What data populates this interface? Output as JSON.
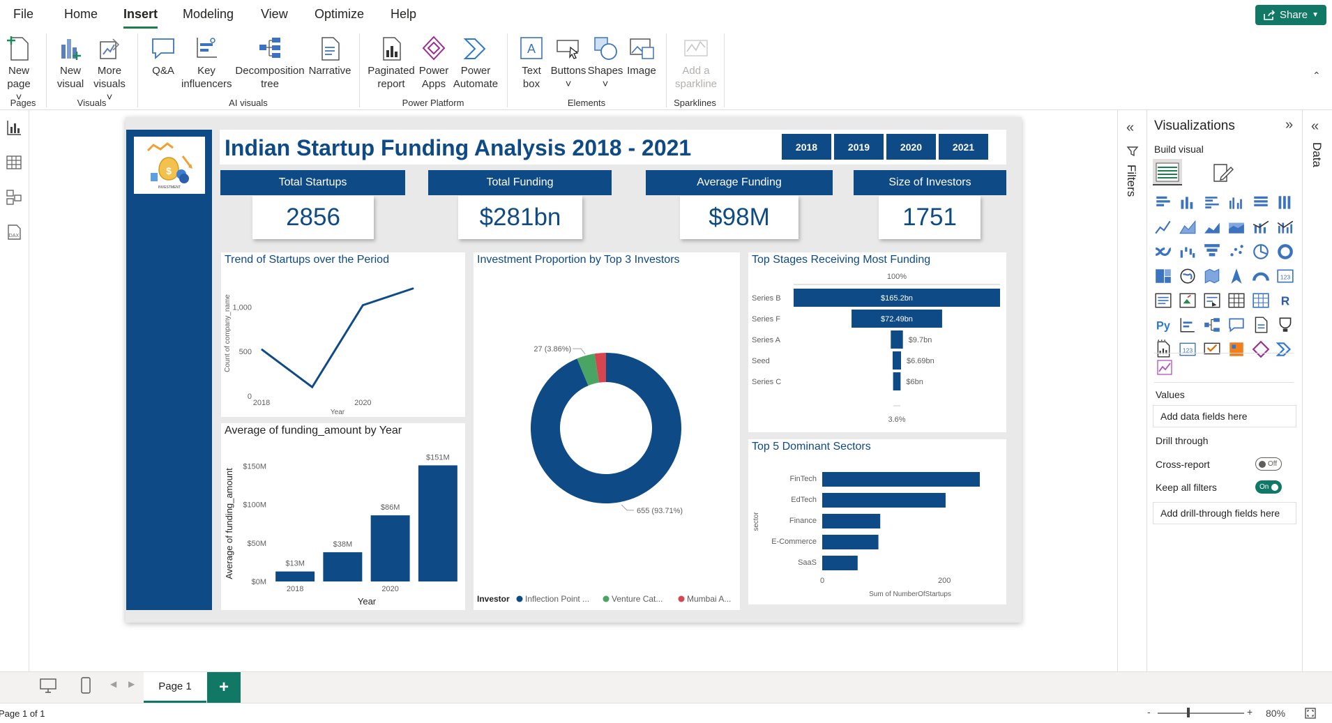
{
  "menu": {
    "items": [
      "File",
      "Home",
      "Insert",
      "Modeling",
      "View",
      "Optimize",
      "Help"
    ],
    "active": "Insert",
    "share_label": "Share"
  },
  "ribbon": {
    "new_page": [
      "New",
      "page"
    ],
    "new_visual": [
      "New",
      "visual"
    ],
    "more_visuals": [
      "More",
      "visuals"
    ],
    "qna": "Q&A",
    "key_influencers": [
      "Key",
      "influencers"
    ],
    "decomposition_tree": [
      "Decomposition",
      "tree"
    ],
    "narrative": "Narrative",
    "paginated_report": [
      "Paginated",
      "report"
    ],
    "power_apps": [
      "Power",
      "Apps"
    ],
    "power_automate": [
      "Power",
      "Automate"
    ],
    "text_box": [
      "Text",
      "box"
    ],
    "buttons": "Buttons",
    "shapes": "Shapes",
    "image": "Image",
    "add_sparkline": [
      "Add a",
      "sparkline"
    ],
    "groups": {
      "pages": "Pages",
      "visuals": "Visuals",
      "ai_visuals": "AI visuals",
      "power_platform": "Power Platform",
      "elements": "Elements",
      "sparklines": "Sparklines"
    }
  },
  "dashboard": {
    "title": "Indian Startup Funding Analysis 2018 - 2021",
    "logo_caption": "INVESTMENT",
    "year_buttons": [
      "2018",
      "2019",
      "2020",
      "2021"
    ],
    "kpis": [
      {
        "label": "Total Startups",
        "value": "2856"
      },
      {
        "label": "Total Funding",
        "value": "$281bn"
      },
      {
        "label": "Average Funding",
        "value": "$98M"
      },
      {
        "label": "Size of Investors",
        "value": "1751"
      }
    ]
  },
  "chart_data": [
    {
      "type": "line",
      "title": "Trend of Startups over the Period",
      "xlabel": "Year",
      "ylabel": "Count of company_name",
      "x": [
        2018,
        2019,
        2020,
        2021
      ],
      "x_ticks": [
        "2018",
        "2020"
      ],
      "y_ticks": [
        "0",
        "500",
        "1,000"
      ],
      "ylim": [
        0,
        1300
      ],
      "series": [
        {
          "values": [
            525,
            100,
            1020,
            1210
          ]
        }
      ]
    },
    {
      "type": "donut",
      "title": "Investment Proportion by Top 3 Investors",
      "legend_title": "Investor",
      "legend": [
        "Inflection Point ...",
        "Venture Cat...",
        "Mumbai A..."
      ],
      "colors": [
        "#0e4a85",
        "#4aa564",
        "#d64550"
      ],
      "values": [
        655,
        27,
        17
      ],
      "labels": [
        "655 (93.71%)",
        "27 (3.86%)",
        ""
      ]
    },
    {
      "type": "funnel",
      "title": "Top Stages Receiving Most Funding",
      "top_pct": "100%",
      "bottom_pct": "3.6%",
      "categories": [
        "Series B",
        "Series F",
        "Series A",
        "Seed",
        "Series C"
      ],
      "values": [
        165.2,
        72.49,
        9.7,
        6.69,
        6
      ],
      "value_labels": [
        "$165.2bn",
        "$72.49bn",
        "$9.7bn",
        "$6.69bn",
        "$6bn"
      ]
    },
    {
      "type": "bar",
      "title": "Average of funding_amount by Year",
      "xlabel": "Year",
      "ylabel": "Average of funding_amount",
      "categories": [
        "2018",
        "2019",
        "2020",
        "2021"
      ],
      "x_tick_labels": [
        "2018",
        "",
        "2020",
        ""
      ],
      "values": [
        13,
        38,
        86,
        151
      ],
      "value_labels": [
        "$13M",
        "$38M",
        "$86M",
        "$151M"
      ],
      "y_ticks": [
        "$0M",
        "$50M",
        "$100M",
        "$150M"
      ],
      "ylim": [
        0,
        165
      ]
    },
    {
      "type": "bar",
      "orientation": "horizontal",
      "title": "Top 5 Dominant Sectors",
      "ylabel": "sector",
      "xlabel": "Sum of NumberOfStartups",
      "categories": [
        "FinTech",
        "EdTech",
        "Finance",
        "E-Commerce",
        "SaaS"
      ],
      "values": [
        258,
        202,
        95,
        92,
        58
      ],
      "x_ticks": [
        "0",
        "200"
      ],
      "xlim": [
        0,
        290
      ]
    }
  ],
  "filters_pane": {
    "label": "Filters"
  },
  "data_pane": {
    "label": "Data"
  },
  "visualizations": {
    "title": "Visualizations",
    "build_visual": "Build visual",
    "more": "...",
    "values_label": "Values",
    "values_placeholder": "Add data fields here",
    "drill_through": "Drill through",
    "cross_report": "Cross-report",
    "cross_report_state": "Off",
    "keep_all_filters": "Keep all filters",
    "keep_all_filters_state": "On",
    "drill_placeholder": "Add drill-through fields here"
  },
  "pages": {
    "tab": "Page 1",
    "add": "+"
  },
  "status": {
    "page_info": "Page 1 of 1",
    "zoom": "80%"
  }
}
